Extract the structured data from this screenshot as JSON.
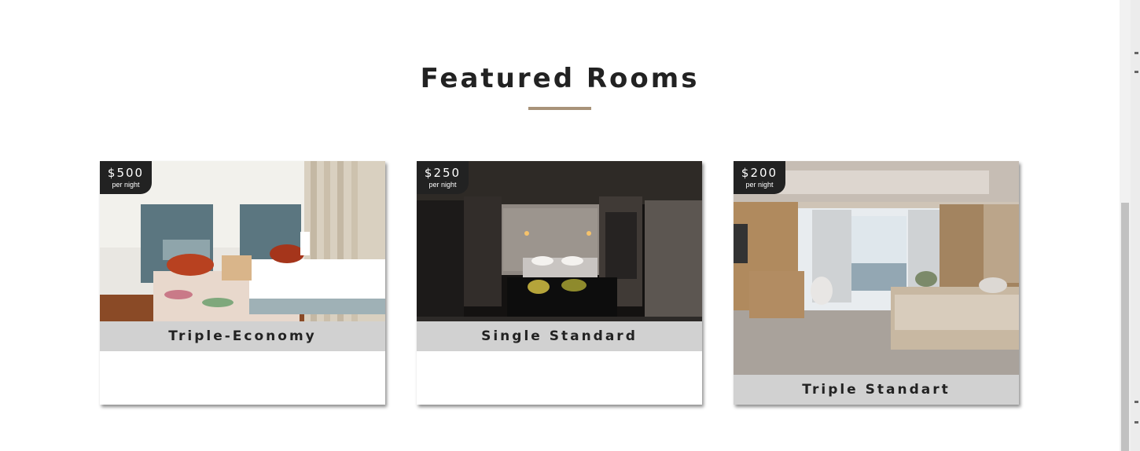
{
  "section": {
    "title": "Featured Rooms",
    "accent_color": "#a89379"
  },
  "rooms": [
    {
      "price": "$500",
      "per_night": "per night",
      "name": "Triple-Economy",
      "image": "twin-bed-room-photo"
    },
    {
      "price": "$250",
      "per_night": "per night",
      "name": "Single Standard",
      "image": "dark-modern-bedroom-photo"
    },
    {
      "price": "$200",
      "per_night": "per night",
      "name": "Triple Standart",
      "image": "bright-bedroom-city-view-photo"
    }
  ]
}
